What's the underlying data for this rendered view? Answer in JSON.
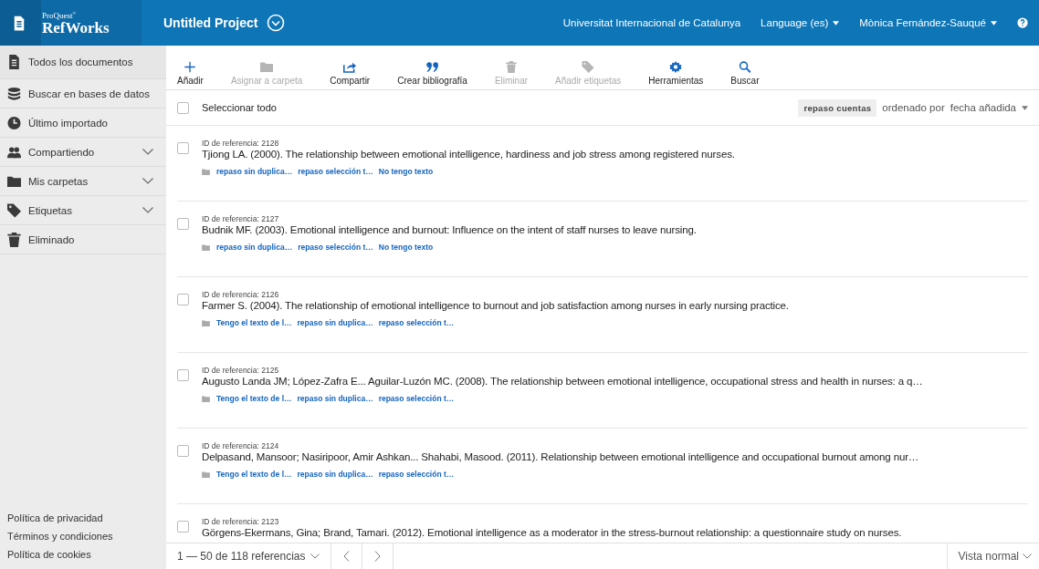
{
  "header": {
    "brand_small": "ProQuest",
    "brand_mark": "®",
    "brand": "RefWorks",
    "project": "Untitled Project",
    "institution": "Universitat Internacional de Catalunya",
    "language": "Language (es)",
    "user": "Mònica Fernández-Sauqué"
  },
  "sidebar": {
    "items": [
      {
        "label": "Todos los documentos",
        "selected": true,
        "expandable": false
      },
      {
        "label": "Buscar en bases de datos",
        "selected": false,
        "expandable": false
      },
      {
        "label": "Último importado",
        "selected": false,
        "expandable": false
      },
      {
        "label": "Compartiendo",
        "selected": false,
        "expandable": true
      },
      {
        "label": "Mis carpetas",
        "selected": false,
        "expandable": true
      },
      {
        "label": "Etiquetas",
        "selected": false,
        "expandable": true
      },
      {
        "label": "Eliminado",
        "selected": false,
        "expandable": false
      }
    ],
    "footer_links": [
      "Política de privacidad",
      "Términos y condiciones",
      "Política de cookies"
    ]
  },
  "toolbar": [
    {
      "label": "Añadir",
      "disabled": false
    },
    {
      "label": "Asignar a carpeta",
      "disabled": true
    },
    {
      "label": "Compartir",
      "disabled": false
    },
    {
      "label": "Crear bibliografía",
      "disabled": false
    },
    {
      "label": "Eliminar",
      "disabled": true
    },
    {
      "label": "Añadir etiquetas",
      "disabled": true
    },
    {
      "label": "Herramientas",
      "disabled": false
    },
    {
      "label": "Buscar",
      "disabled": false
    }
  ],
  "list_header": {
    "select_all": "Seleccionar todo",
    "checked": false,
    "badge": "repaso cuentas",
    "sort_prefix": "ordenado por",
    "sort_field": "fecha añadida"
  },
  "references": [
    {
      "id": "ID de referencia: 2128",
      "citation": "Tjiong LA. (2000). The relationship between emotional intelligence, hardiness and job stress among registered nurses.",
      "checked": false,
      "tags": [
        "repaso sin duplica…",
        "repaso selección t…",
        "No tengo texto"
      ]
    },
    {
      "id": "ID de referencia: 2127",
      "citation": "Budnik MF. (2003). Emotional intelligence and burnout: Influence on the intent of staff nurses to leave nursing.",
      "checked": false,
      "tags": [
        "repaso sin duplica…",
        "repaso selección t…",
        "No tengo texto"
      ]
    },
    {
      "id": "ID de referencia: 2126",
      "citation": "Farmer S. (2004). The relationship of emotional intelligence to burnout and job satisfaction among nurses in early nursing practice.",
      "checked": false,
      "tags": [
        "Tengo el texto de l…",
        "repaso sin duplica…",
        "repaso selección t…"
      ]
    },
    {
      "id": "ID de referencia: 2125",
      "citation": "Augusto Landa JM; López-Zafra E... Aguilar-Luzón MC. (2008). The relationship between emotional intelligence, occupational stress and health in nurses: a q…",
      "checked": false,
      "tags": [
        "Tengo el texto de l…",
        "repaso sin duplica…",
        "repaso selección t…"
      ]
    },
    {
      "id": "ID de referencia: 2124",
      "citation": "Delpasand, Mansoor; Nasiripoor, Amir Ashkan... Shahabi, Masood. (2011). Relationship between emotional intelligence and occupational burnout among nur…",
      "checked": false,
      "tags": [
        "Tengo el texto de l…",
        "repaso sin duplica…",
        "repaso selección t…"
      ]
    },
    {
      "id": "ID de referencia: 2123",
      "citation": "Görgens-Ekermans, Gina; Brand, Tamari. (2012). Emotional intelligence as a moderator in the stress-burnout relationship: a questionnaire study on nurses.",
      "checked": false
    }
  ],
  "pagination": {
    "range": "1 — 50 de 118 referencias",
    "view": "Vista normal"
  }
}
